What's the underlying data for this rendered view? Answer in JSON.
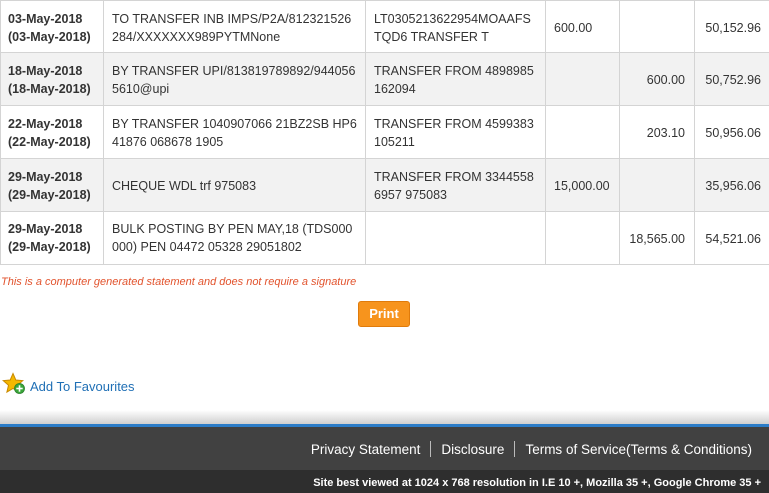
{
  "transactions": [
    {
      "date": "03-May-2018",
      "value_date": "(03-May-2018)",
      "narration": "TO TRANSFER INB IMPS/P2A/812321526284/XXXXXXX989PYTMNone",
      "reference": "LT0305213622954MOAAFSTQD6 TRANSFER T",
      "debit": "600.00",
      "credit": "",
      "balance": "50,152.96"
    },
    {
      "date": "18-May-2018",
      "value_date": "(18-May-2018)",
      "narration": "BY TRANSFER UPI/813819789892/9440565610@upi",
      "reference": "TRANSFER FROM 4898985162094",
      "debit": "",
      "credit": "600.00",
      "balance": "50,752.96"
    },
    {
      "date": "22-May-2018",
      "value_date": "(22-May-2018)",
      "narration": "BY TRANSFER 1040907066 21BZ2SB HP641876 068678 1905",
      "reference": "TRANSFER FROM 4599383105211",
      "debit": "",
      "credit": "203.10",
      "balance": "50,956.06"
    },
    {
      "date": "29-May-2018",
      "value_date": "(29-May-2018)",
      "narration": "CHEQUE WDL trf 975083",
      "reference": "TRANSFER FROM 33445586957 975083",
      "debit": "15,000.00",
      "credit": "",
      "balance": "35,956.06"
    },
    {
      "date": "29-May-2018",
      "value_date": "(29-May-2018)",
      "narration": "BULK POSTING BY PEN MAY,18 (TDS000000) PEN 04472 05328 29051802",
      "reference": "",
      "debit": "",
      "credit": "18,565.00",
      "balance": "54,521.06"
    }
  ],
  "disclaimer": "This is a computer generated statement and does not require a signature",
  "print_label": "Print",
  "favourites": {
    "label": "Add To Favourites",
    "icon": "star-plus-icon"
  },
  "footer": {
    "links": [
      "Privacy Statement",
      "Disclosure",
      "Terms of Service(Terms & Conditions)"
    ],
    "note": "Site best viewed at 1024 x 768 resolution in I.E 10 +, Mozilla 35 +, Google Chrome 35 +"
  },
  "colors": {
    "accent_orange": "#f7941d",
    "disclaimer_red": "#e2532d",
    "link_blue": "#1f6fb5",
    "footer_bg": "#414141",
    "footer_border": "#2c7cc7"
  }
}
